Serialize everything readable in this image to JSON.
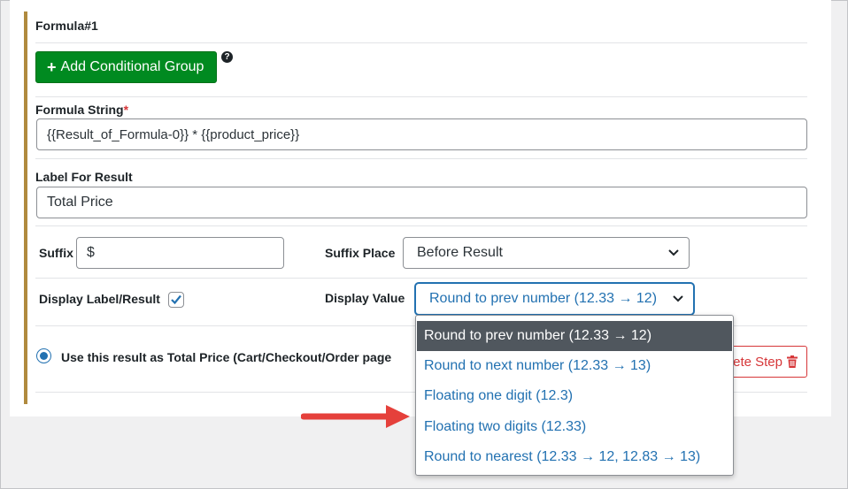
{
  "formula": {
    "heading": "Formula#1",
    "add_group_label": "Add Conditional Group",
    "help_glyph": "?",
    "formula_string_label": "Formula String",
    "required_mark": "*",
    "formula_string_value": "{{Result_of_Formula-0}} * {{product_price}}",
    "label_for_result_label": "Label For Result",
    "label_for_result_value": "Total Price",
    "suffix_label": "Suffix",
    "suffix_value": "$",
    "suffix_place_label": "Suffix Place",
    "suffix_place_value": "Before Result",
    "display_label_result_label": "Display Label/Result",
    "display_label_result_checked": true,
    "display_value_label": "Display Value",
    "display_value_selected": "Round to prev number (12.33 → 12)",
    "total_price_radio_label": "Use this result as Total Price (Cart/Checkout/Order page)",
    "total_price_radio_label_visible": "Use this result as Total Price (Cart/Checkout/Order page",
    "delete_step_label_visible": "ete Step"
  },
  "dropdown": {
    "options": [
      "Round to prev number (12.33 → 12)",
      "Round to next number (12.33 → 13)",
      "Floating one digit (12.3)",
      "Floating two digits (12.33)",
      "Round to nearest (12.33 → 12, 12.83 → 13)"
    ],
    "selected_index": 0
  },
  "colors": {
    "accent_bar": "#b08a3e",
    "primary_green": "#008a20",
    "link_blue": "#2271b1",
    "danger_red": "#d63638",
    "selected_option_bg": "#50575e",
    "annotation_arrow": "#e5403b"
  },
  "icons": [
    "plus-icon",
    "help-icon",
    "chevron-down-icon",
    "checkmark-icon",
    "trash-icon",
    "annotation-arrow-icon"
  ]
}
